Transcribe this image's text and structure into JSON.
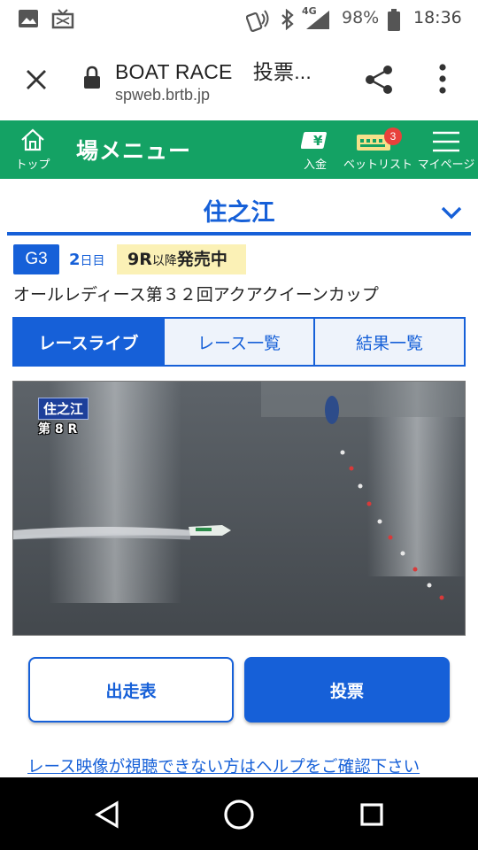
{
  "status_bar": {
    "battery": "98%",
    "time": "18:36",
    "network": "4G",
    "icons": [
      "image-icon",
      "tv-icon",
      "nfc-icon",
      "bluetooth-icon",
      "signal-icon",
      "battery-icon"
    ]
  },
  "browser": {
    "title": "BOAT RACE　投票...",
    "url": "spweb.brtb.jp",
    "icons": [
      "close-icon",
      "lock-icon",
      "share-icon",
      "more-icon"
    ]
  },
  "nav": {
    "top_label": "トップ",
    "title": "場メニュー",
    "deposit_label": "入金",
    "betlist_label": "ベットリスト",
    "betlist_badge": "3",
    "mypage_label": "マイページ",
    "deposit_symbol": "¥",
    "color": "#14a264"
  },
  "venue": {
    "name": "住之江"
  },
  "race": {
    "grade": "G3",
    "day_num": "2",
    "day_unit": "日目",
    "sale_race": "9R",
    "sale_mid": "以降",
    "sale_end": "発売中",
    "name": "オールレディース第３２回アクアクイーンカップ"
  },
  "tabs": [
    {
      "label": "レースライブ",
      "active": true
    },
    {
      "label": "レース一覧",
      "active": false
    },
    {
      "label": "結果一覧",
      "active": false
    }
  ],
  "video": {
    "overlay_venue": "住之江",
    "overlay_race": "第 8 R"
  },
  "buttons": {
    "entry_label": "出走表",
    "vote_label": "投票"
  },
  "help_link": "レース映像が視聴できない方はヘルプをご確認下さい",
  "accent_color": "#1660d8"
}
